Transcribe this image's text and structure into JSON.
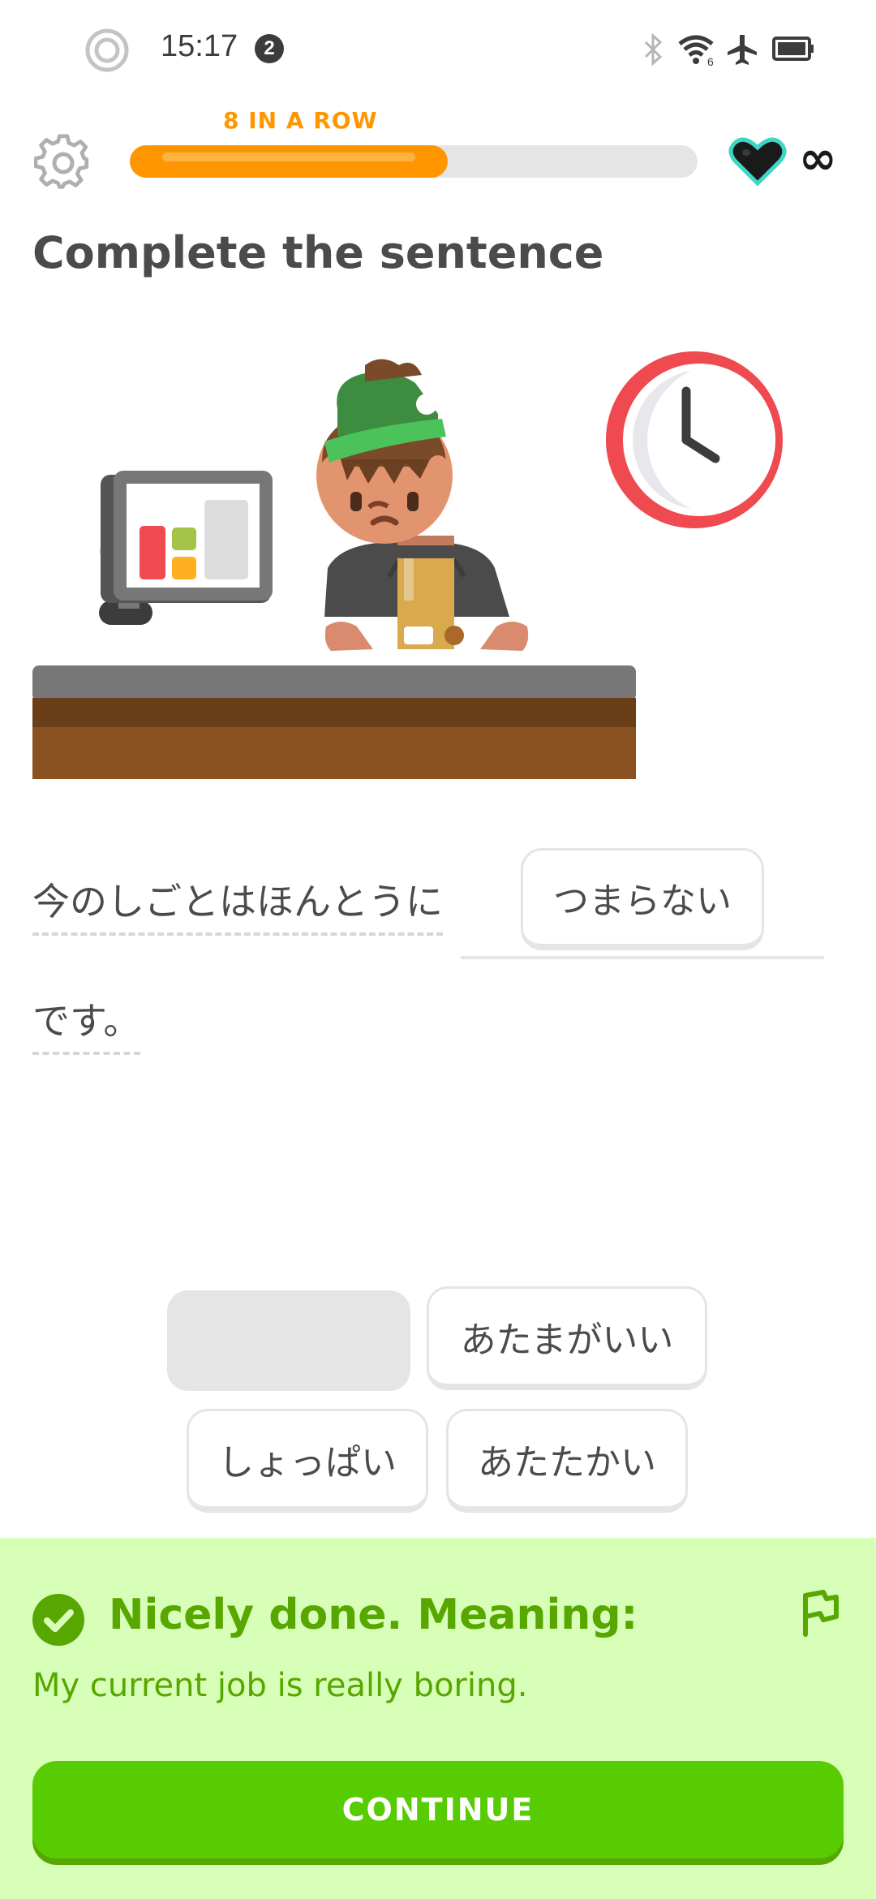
{
  "status_bar": {
    "time": "15:17",
    "notification_count": "2",
    "icons": [
      "record-icon",
      "bluetooth-icon",
      "wifi-icon",
      "airplane-icon",
      "battery-icon"
    ]
  },
  "header": {
    "streak_label": "8 IN A ROW",
    "progress_fraction": 0.56,
    "hearts_label": "∞",
    "accent_color": "#ff9600"
  },
  "exercise": {
    "instruction": "Complete the sentence",
    "sentence_before": "今のしごとはほんとうに",
    "selected_answer": "つまらない",
    "sentence_after": "です。"
  },
  "word_bank": [
    {
      "label": "",
      "used": true
    },
    {
      "label": "あたまがいい",
      "used": false
    },
    {
      "label": "しょっぱい",
      "used": false
    },
    {
      "label": "あたたかい",
      "used": false
    }
  ],
  "feedback": {
    "title": "Nicely done. Meaning:",
    "translation": "My current job is really boring.",
    "continue_label": "CONTINUE",
    "success_color": "#58cc02"
  }
}
